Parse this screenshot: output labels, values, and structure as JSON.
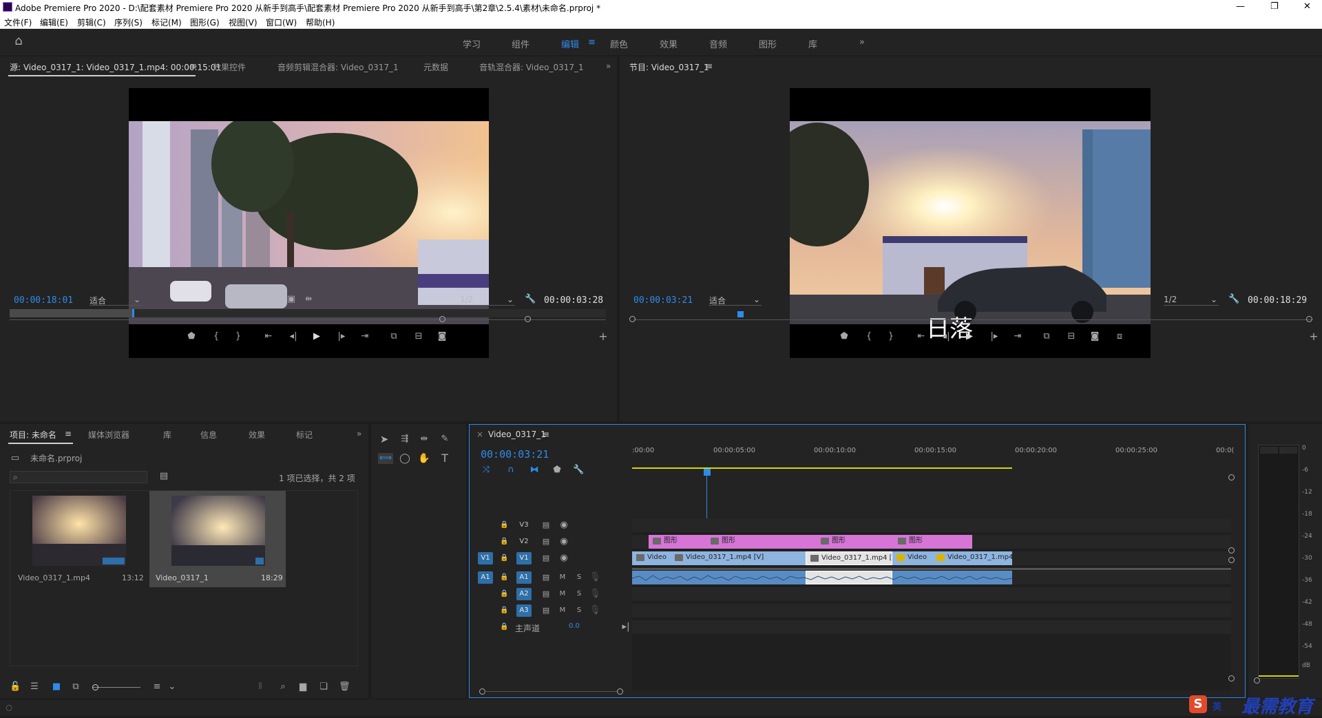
{
  "window": {
    "title": "Adobe Premiere Pro 2020 - D:\\配套素材 Premiere Pro 2020 从新手到高手\\配套素材 Premiere Pro 2020 从新手到高手\\第2章\\2.5.4\\素材\\未命名.prproj *"
  },
  "menu": [
    "文件(F)",
    "编辑(E)",
    "剪辑(C)",
    "序列(S)",
    "标记(M)",
    "图形(G)",
    "视图(V)",
    "窗口(W)",
    "帮助(H)"
  ],
  "workspaces": [
    "学习",
    "组件",
    "编辑",
    "颜色",
    "效果",
    "音频",
    "图形",
    "库"
  ],
  "active_workspace": "编辑",
  "source": {
    "tabs": [
      "源: Video_0317_1: Video_0317_1.mp4: 00:00:15:01",
      "效果控件",
      "音频剪辑混合器: Video_0317_1",
      "元数据",
      "音轨混合器: Video_0317_1"
    ],
    "timecode": "00:00:18:01",
    "fit": "适合",
    "resolution": "1/2",
    "duration": "00:00:03:28",
    "playhead_fraction": 0.41
  },
  "program": {
    "tab": "节目: Video_0317_1",
    "timecode": "00:00:03:21",
    "fit": "适合",
    "resolution": "1/2",
    "duration": "00:00:18:29",
    "overlay_title": "日落",
    "playhead_fraction": 0.19
  },
  "project": {
    "tabs": [
      "项目: 未命名",
      "媒体浏览器",
      "库",
      "信息",
      "效果",
      "标记"
    ],
    "file": "未命名.prproj",
    "selection": "1 项已选择，共 2 项",
    "items": [
      {
        "name": "Video_0317_1.mp4",
        "duration": "13:12"
      },
      {
        "name": "Video_0317_1",
        "duration": "18:29"
      }
    ]
  },
  "timeline": {
    "tab": "Video_0317_1",
    "timecode": "00:00:03:21",
    "ruler": [
      ":00:00",
      "00:00:05:00",
      "00:00:10:00",
      "00:00:15:00",
      "00:00:20:00",
      "00:00:25:00",
      "00:0("
    ],
    "video_tracks": [
      {
        "name": "V3",
        "target": ""
      },
      {
        "name": "V2",
        "target": ""
      },
      {
        "name": "V1",
        "target": "V1"
      }
    ],
    "audio_tracks": [
      {
        "name": "A1",
        "target": "A1"
      },
      {
        "name": "A2",
        "target": ""
      },
      {
        "name": "A3",
        "target": ""
      }
    ],
    "track_m": "M",
    "track_s": "S",
    "master_label": "主声道",
    "master_value": "0.0",
    "graphic_clips": [
      "图形",
      "图形",
      "图形",
      "图形"
    ],
    "video_clips": [
      "Video",
      "Video_0317_1.mp4 [V]",
      "Video_0317_1.mp4 [V",
      "Video",
      "Video_0317_1.mp4 ["
    ]
  },
  "meter": {
    "scale": [
      "0",
      "-6",
      "-12",
      "-18",
      "-24",
      "-30",
      "-36",
      "-42",
      "-48",
      "-54",
      "dB"
    ]
  },
  "colors": {
    "accent": "#2d8ceb",
    "graphic_clip": "#d775d7",
    "video_clip": "#8eb4e0",
    "audio_clip": "#5a8cc4"
  },
  "watermark": {
    "brand": "最需教育",
    "ime": "英"
  }
}
